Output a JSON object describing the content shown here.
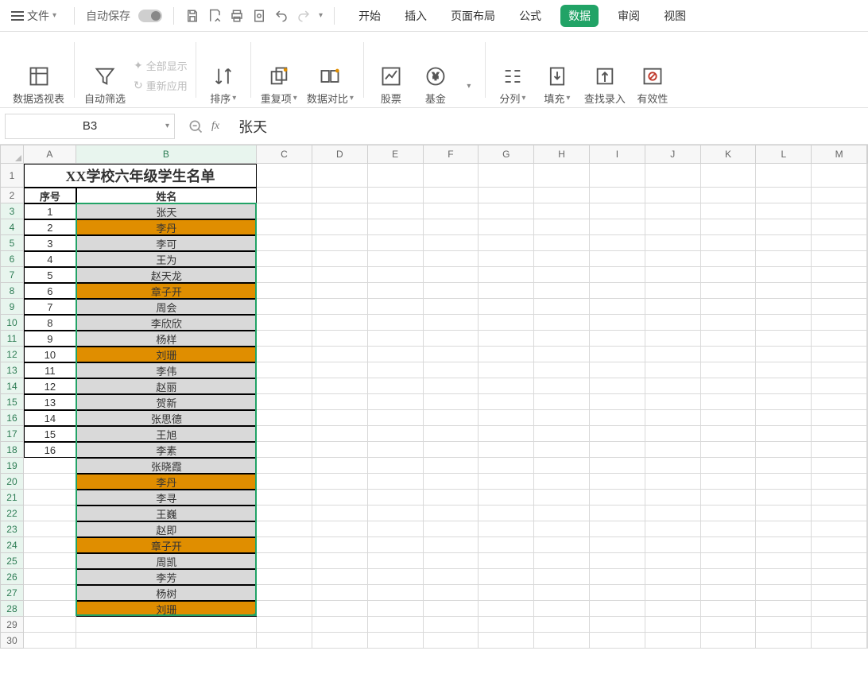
{
  "menu": {
    "file": "文件",
    "autosave": "自动保存",
    "tabs": [
      "开始",
      "插入",
      "页面布局",
      "公式",
      "数据",
      "审阅",
      "视图"
    ],
    "active_tab_index": 4
  },
  "ribbon": {
    "pivot": "数据透视表",
    "filter": "自动筛选",
    "show_all": "全部显示",
    "reapply": "重新应用",
    "sort": "排序",
    "dup": "重复项",
    "compare": "数据对比",
    "stock": "股票",
    "fund": "基金",
    "split": "分列",
    "fill": "填充",
    "find_input": "查找录入",
    "validity": "有效性"
  },
  "formula_bar": {
    "name": "B3",
    "value": "张天"
  },
  "sheet": {
    "columns": [
      "A",
      "B",
      "C",
      "D",
      "E",
      "F",
      "G",
      "H",
      "I",
      "J",
      "K",
      "L",
      "M"
    ],
    "title": "XX学校六年级学生名单",
    "header": {
      "a": "序号",
      "b": "姓名"
    },
    "rows": [
      {
        "n": "1",
        "name": "张天",
        "hl": false
      },
      {
        "n": "2",
        "name": "李丹",
        "hl": true
      },
      {
        "n": "3",
        "name": "李可",
        "hl": false
      },
      {
        "n": "4",
        "name": "王为",
        "hl": false
      },
      {
        "n": "5",
        "name": "赵天龙",
        "hl": false
      },
      {
        "n": "6",
        "name": "章子开",
        "hl": true
      },
      {
        "n": "7",
        "name": "周会",
        "hl": false
      },
      {
        "n": "8",
        "name": "李欣欣",
        "hl": false
      },
      {
        "n": "9",
        "name": "杨样",
        "hl": false
      },
      {
        "n": "10",
        "name": "刘珊",
        "hl": true
      },
      {
        "n": "11",
        "name": "李伟",
        "hl": false
      },
      {
        "n": "12",
        "name": "赵丽",
        "hl": false
      },
      {
        "n": "13",
        "name": "贺新",
        "hl": false
      },
      {
        "n": "14",
        "name": "张思德",
        "hl": false
      },
      {
        "n": "15",
        "name": "王旭",
        "hl": false
      },
      {
        "n": "16",
        "name": "李素",
        "hl": false
      },
      {
        "n": "",
        "name": "张晓霞",
        "hl": false
      },
      {
        "n": "",
        "name": "李丹",
        "hl": true
      },
      {
        "n": "",
        "name": "李寻",
        "hl": false
      },
      {
        "n": "",
        "name": "王巍",
        "hl": false
      },
      {
        "n": "",
        "name": "赵即",
        "hl": false
      },
      {
        "n": "",
        "name": "章子开",
        "hl": true
      },
      {
        "n": "",
        "name": "周凯",
        "hl": false
      },
      {
        "n": "",
        "name": "李芳",
        "hl": false
      },
      {
        "n": "",
        "name": "杨树",
        "hl": false
      },
      {
        "n": "",
        "name": "刘珊",
        "hl": true
      }
    ],
    "empty_rows": [
      29,
      30
    ]
  }
}
